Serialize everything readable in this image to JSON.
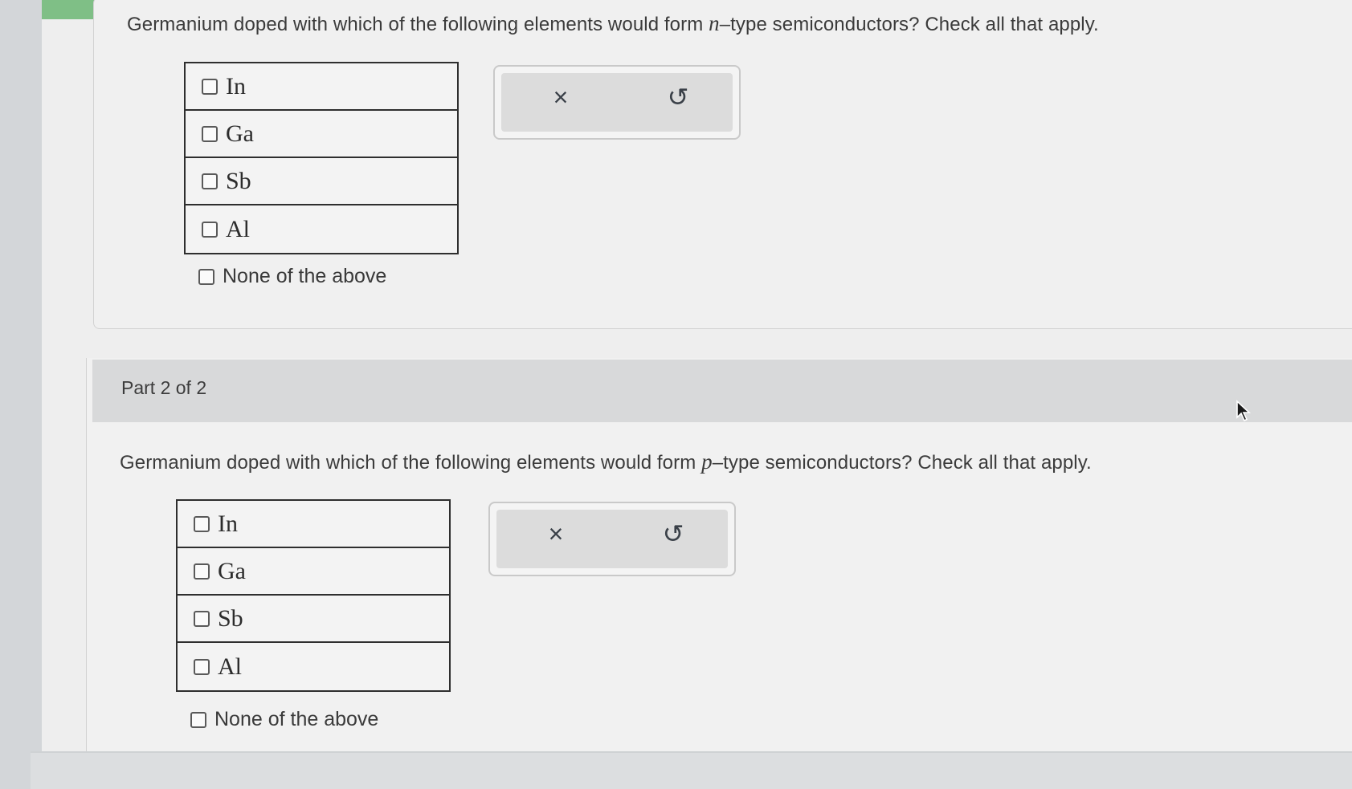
{
  "part1": {
    "question_before": "Germanium doped with which of the following elements would form ",
    "question_var": "n",
    "question_after": "–type semiconductors? Check all that apply.",
    "options": [
      {
        "label": "In"
      },
      {
        "label": "Ga"
      },
      {
        "label": "Sb"
      },
      {
        "label": "Al"
      }
    ],
    "none_label": "None of the above",
    "clear_glyph": "×",
    "undo_glyph": "↺"
  },
  "part2": {
    "header": "Part 2 of 2",
    "question_before": "Germanium doped with which of the following elements would form ",
    "question_var": "p",
    "question_after": "–type semiconductors? Check all that apply.",
    "options": [
      {
        "label": "In"
      },
      {
        "label": "Ga"
      },
      {
        "label": "Sb"
      },
      {
        "label": "Al"
      }
    ],
    "none_label": "None of the above",
    "clear_glyph": "×",
    "undo_glyph": "↺"
  },
  "icons": {
    "clear": "x-icon",
    "undo": "undo-icon",
    "cursor": "mouse-pointer-icon"
  },
  "colors": {
    "accent_bar": "#7fbf86",
    "header_band": "#d8d9da",
    "table_border": "#2e2e2e"
  }
}
